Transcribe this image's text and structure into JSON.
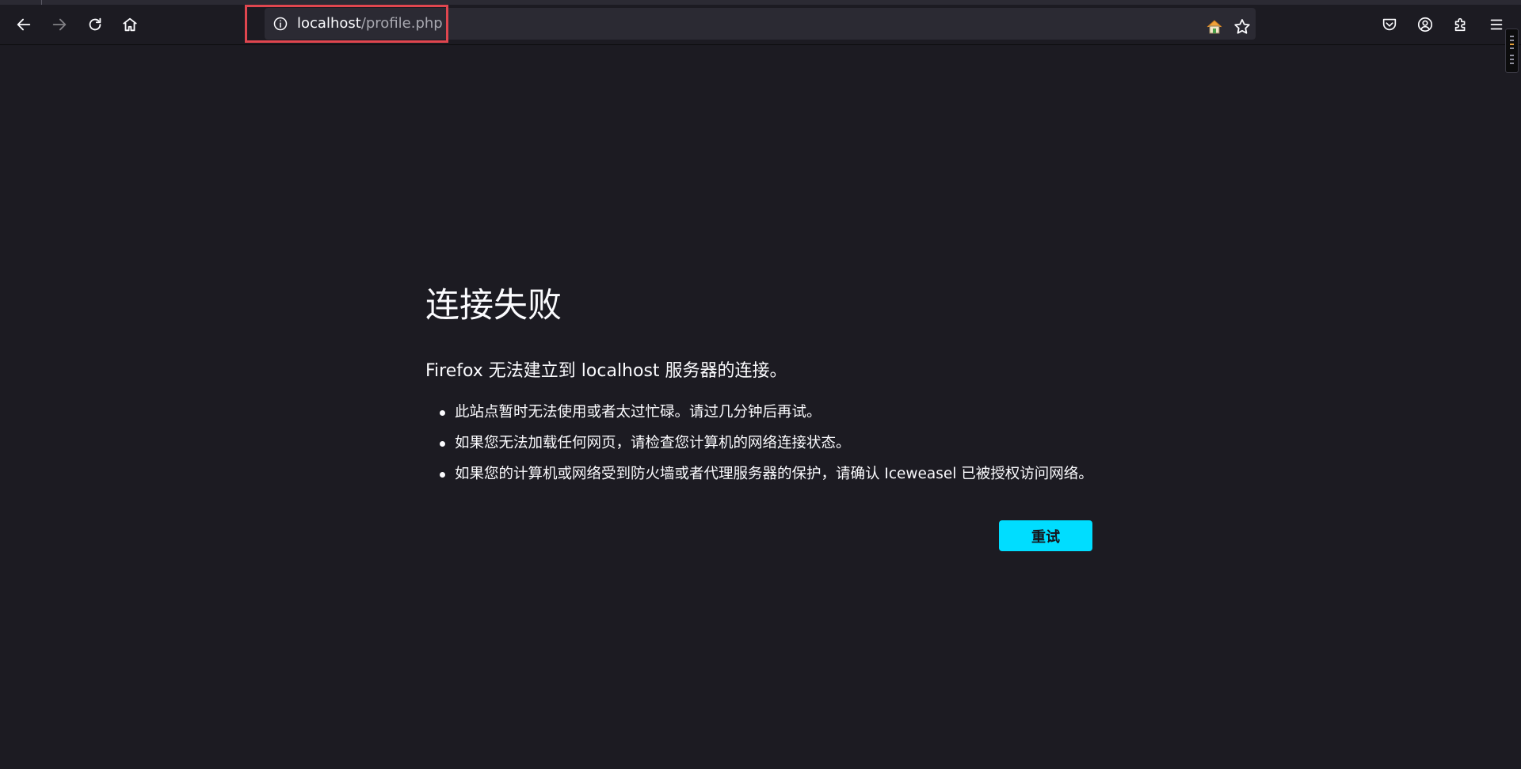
{
  "browser": {
    "url_host": "localhost",
    "url_path": "/profile.php",
    "icons": {
      "back": "back-arrow-icon",
      "forward": "forward-arrow-icon",
      "reload": "reload-icon",
      "home": "home-icon",
      "site_info": "info-circle-icon",
      "house_badge": "house-icon",
      "bookmark": "star-icon",
      "pocket": "pocket-icon",
      "account": "account-icon",
      "extensions": "puzzle-icon",
      "menu": "hamburger-menu-icon"
    }
  },
  "error_page": {
    "title": "连接失败",
    "description": "Firefox 无法建立到 localhost 服务器的连接。",
    "items": [
      "此站点暂时无法使用或者太过忙碌。请过几分钟后再试。",
      "如果您无法加载任何网页，请检查您计算机的网络连接状态。",
      "如果您的计算机或网络受到防火墙或者代理服务器的保护，请确认 Iceweasel 已被授权访问网络。"
    ],
    "retry_label": "重试"
  },
  "colors": {
    "page_background": "#1c1b22",
    "toolbar_background": "#1c1b22",
    "urlbar_background": "#2b2a33",
    "primary_button": "#00ddff",
    "highlight_box": "#e0464f",
    "text": "#fbfbfe"
  }
}
